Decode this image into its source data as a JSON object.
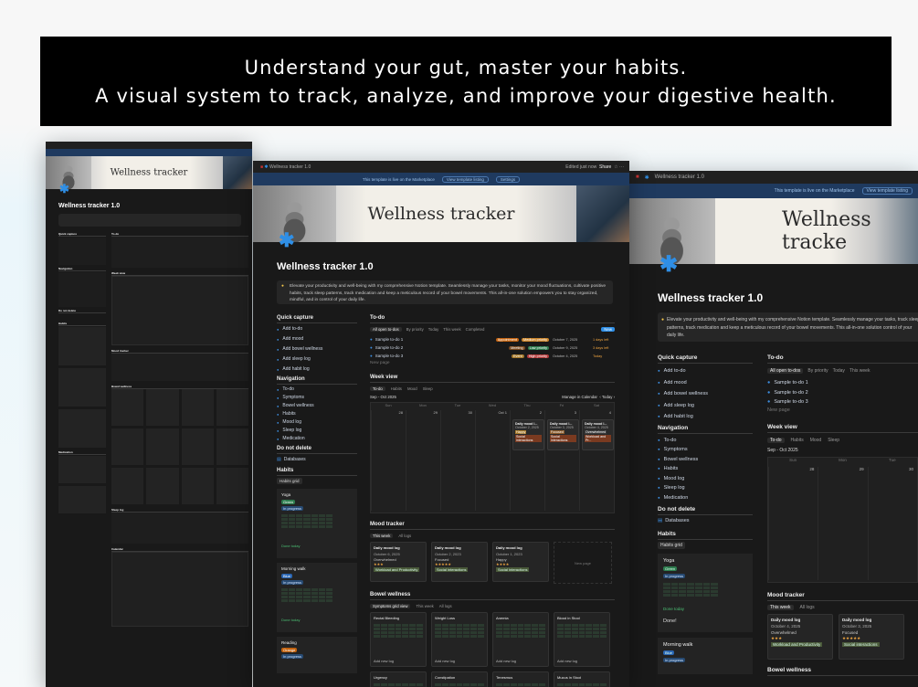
{
  "banner": {
    "line1": "Understand your gut, master your habits.",
    "line2": "A visual system to track, analyze, and improve your digestive health."
  },
  "center": {
    "tab_title": "Wellness tracker 1.0",
    "topbar_right": [
      "Edited just now",
      "Share"
    ],
    "marketplace_text": "This template is live on the Marketplace",
    "view_listing": "View template listing",
    "settings": "Settings",
    "hero_title": "Wellness tracker",
    "page_title": "Wellness tracker 1.0",
    "callout": "Elevate your productivity and well-being with my comprehensive Notion template. Seamlessly manage your tasks, monitor your mood fluctuations, cultivate positive habits, track sleep patterns, track medication and keep a meticulous record of your bowel movements. This all-in-one solution empowers you to stay organized, mindful, and in control of your daily life.",
    "quick_capture": {
      "title": "Quick capture",
      "items": [
        "Add to-do",
        "Add mood",
        "Add bowel wellness",
        "Add sleep log",
        "Add habit log"
      ]
    },
    "navigation": {
      "title": "Navigation",
      "items": [
        "To-do",
        "Symptoms",
        "Bowel wellness",
        "Habits",
        "Mood log",
        "Sleep log",
        "Medication"
      ]
    },
    "do_not_delete": {
      "title": "Do not delete",
      "items": [
        "Databases"
      ]
    },
    "habits": {
      "title": "Habits",
      "view": "Habits grid",
      "cards": [
        {
          "name": "Yoga",
          "tag1": "Green",
          "tag2": "In progress",
          "done": "Done today"
        },
        {
          "name": "Morning walk",
          "tag1": "Blue",
          "tag2": "In progress",
          "done": "Done today"
        },
        {
          "name": "Reading",
          "tag1": "Orange",
          "tag2": "In progress"
        }
      ]
    },
    "todo": {
      "title": "To-do",
      "views": [
        "All open to-dos",
        "By priority",
        "Today",
        "This week",
        "Completed"
      ],
      "new": "New",
      "rows": [
        {
          "name": "Sample to-do 1",
          "tag": "Appointment",
          "prio": "Medium priority",
          "date": "October 7, 2025",
          "extra": "1 days left"
        },
        {
          "name": "Sample to-do 2",
          "tag": "Meeting",
          "prio": "Low priority",
          "date": "October 9, 2025",
          "extra": "3 days left"
        },
        {
          "name": "Sample to-do 3",
          "tag": "Event",
          "prio": "High priority",
          "date": "October 4, 2025",
          "extra": "Today"
        }
      ],
      "new_page": "New page"
    },
    "week": {
      "title": "Week view",
      "views": [
        "To-do",
        "Habits",
        "Mood",
        "Sleep"
      ],
      "range": "Sep - Oct 2025",
      "manage": "Manage in Calendar",
      "today": "Today",
      "days": [
        "Sun",
        "Mon",
        "Tue",
        "Wed",
        "Thu",
        "Fri",
        "Sat"
      ],
      "dates": [
        "28",
        "29",
        "30",
        "Oct 1",
        "2",
        "3",
        "4"
      ],
      "entries": [
        {
          "title": "Daily mood l...",
          "date": "October 2, 2025",
          "mood": "Happy",
          "tag": "Social interactions"
        },
        {
          "title": "Daily mood l...",
          "date": "October 3, 2025",
          "mood": "Focused",
          "tag": "Social interactions"
        },
        {
          "title": "Daily mood l...",
          "date": "October 4, 2025",
          "mood": "Overwhelmed",
          "tag": "Workload and Pr..."
        }
      ]
    },
    "mood": {
      "title": "Mood tracker",
      "views": [
        "This week",
        "All logs"
      ],
      "cards": [
        {
          "title": "Daily mood log",
          "date": "October 6, 2025",
          "mood": "Overwhelmed",
          "rating": "★★★",
          "tag": "Workload and Productivity"
        },
        {
          "title": "Daily mood log",
          "date": "October 2, 2023",
          "mood": "Focused",
          "rating": "★★★★★",
          "tag": "Social interactions"
        },
        {
          "title": "Daily mood log",
          "date": "October 1, 2023",
          "mood": "Happy",
          "rating": "★★★★",
          "tag": "Social interactions"
        }
      ],
      "new_page": "New page"
    },
    "bowel": {
      "title": "Bowel wellness",
      "views": [
        "Symptoms grid view",
        "This week",
        "All logs"
      ],
      "cards": [
        "Rectal Bleeding",
        "Weight Loss",
        "Anemia",
        "Blood in Stool"
      ],
      "add": "Add new log",
      "cards2": [
        "Urgency",
        "Constipation",
        "Tenesmus",
        "Mucus in Stool"
      ]
    }
  },
  "right": {
    "tab_title": "Wellness tracker 1.0",
    "marketplace_text": "This template is live on the Marketplace",
    "view_listing": "View template listing",
    "hero_title": "Wellness tracke",
    "page_title": "Wellness tracker 1.0",
    "callout": "Elevate your productivity and well-being with my comprehensive Notion template. Seamlessly manage your tasks, track sleep patterns, track medication and keep a meticulous record of your bowel movements. This all-in-one solution control of your daily life.",
    "quick_capture": {
      "title": "Quick capture",
      "items": [
        "Add to-do",
        "Add mood",
        "Add bowel wellness",
        "Add sleep log",
        "Add habit log"
      ]
    },
    "navigation": {
      "title": "Navigation",
      "items": [
        "To-do",
        "Symptoms",
        "Bowel wellness",
        "Habits",
        "Mood log",
        "Sleep log",
        "Medication"
      ]
    },
    "do_not_delete": {
      "title": "Do not delete",
      "items": [
        "Databases"
      ]
    },
    "habits": {
      "title": "Habits",
      "view": "Habits grid",
      "cards": [
        {
          "name": "Yoga",
          "tag1": "Green",
          "tag2": "In progress",
          "done": "Done today",
          "done2": "Done!"
        },
        {
          "name": "Morning walk",
          "tag1": "Blue",
          "tag2": "In progress"
        }
      ]
    },
    "todo": {
      "title": "To-do",
      "views": [
        "All open to-dos",
        "By priority",
        "Today",
        "This week"
      ],
      "rows": [
        "Sample to-do 1",
        "Sample to-do 2",
        "Sample to-do 3"
      ],
      "new_page": "New page"
    },
    "week": {
      "title": "Week view",
      "views": [
        "To-do",
        "Habits",
        "Mood",
        "Sleep"
      ],
      "range": "Sep - Oct 2025",
      "days": [
        "Sun",
        "Mon",
        "Tue"
      ],
      "dates": [
        "28",
        "29",
        "30"
      ]
    },
    "mood": {
      "title": "Mood tracker",
      "views": [
        "This week",
        "All logs"
      ],
      "cards": [
        {
          "title": "Daily mood log",
          "date": "October 4, 2025",
          "mood": "Overwhelmed",
          "rating": "★★★",
          "tag": "Workload and Productivity"
        },
        {
          "title": "Daily mood log",
          "date": "October 3, 2025",
          "mood": "Focused",
          "rating": "★★★★★",
          "tag": "Social interactions"
        }
      ]
    },
    "bowel": {
      "title": "Bowel wellness"
    }
  },
  "left": {
    "hero_title": "Wellness tracker",
    "page_title": "Wellness tracker 1.0",
    "sections": [
      "Quick capture",
      "Navigation",
      "Do not delete",
      "Habits",
      "Medication",
      "To-do",
      "Week view",
      "Mood tracker",
      "Bowel wellness",
      "Sleep log",
      "Calendar"
    ]
  },
  "colors": {
    "accent": "#2f8fe6",
    "bg": "#191919",
    "banner": "#000000"
  }
}
